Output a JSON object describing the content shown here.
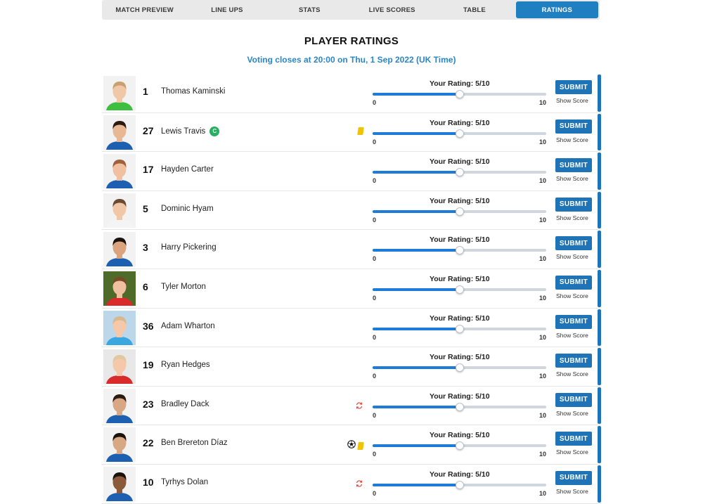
{
  "tabs": [
    {
      "label": "MATCH PREVIEW",
      "active": false
    },
    {
      "label": "LINE UPS",
      "active": false
    },
    {
      "label": "STATS",
      "active": false
    },
    {
      "label": "LIVE SCORES",
      "active": false
    },
    {
      "label": "TABLE",
      "active": false
    },
    {
      "label": "RATINGS",
      "active": true
    }
  ],
  "page_title": "PLAYER RATINGS",
  "voting_text": "Voting closes at 20:00 on Thu, 1 Sep 2022 (UK Time)",
  "slider_min_label": "0",
  "slider_max_label": "10",
  "submit_label": "SUBMIT",
  "show_score_label": "Show Score",
  "colors": {
    "accent": "#1f74b8",
    "tab_active": "#1f7fc0",
    "voting_text": "#2a86c6",
    "captain": "#27ae60",
    "yellow_card": "#f2c300",
    "sub_icon": "#e74c3c"
  },
  "players": [
    {
      "number": "1",
      "name": "Thomas Kaminski",
      "rating_label": "Your Rating: 5/10",
      "rating": 5,
      "captain": false,
      "events": [],
      "kit": "green",
      "bg": "#f2f2f2",
      "skin": "#f0c8a8",
      "hair": "#c9a070"
    },
    {
      "number": "27",
      "name": "Lewis Travis",
      "rating_label": "Your Rating: 5/10",
      "rating": 5,
      "captain": true,
      "captain_label": "C",
      "events": [
        "yellow-card"
      ],
      "kit": "blue",
      "bg": "#f2f2f2",
      "skin": "#e8b894",
      "hair": "#2a1a10"
    },
    {
      "number": "17",
      "name": "Hayden Carter",
      "rating_label": "Your Rating: 5/10",
      "rating": 5,
      "captain": false,
      "events": [],
      "kit": "blue",
      "bg": "#f2f2f2",
      "skin": "#f0c0a0",
      "hair": "#a0603a"
    },
    {
      "number": "5",
      "name": "Dominic Hyam",
      "rating_label": "Your Rating: 5/10",
      "rating": 5,
      "captain": false,
      "events": [],
      "kit": "white",
      "bg": "#f2f2f2",
      "skin": "#f0c8a8",
      "hair": "#6a4a30"
    },
    {
      "number": "3",
      "name": "Harry Pickering",
      "rating_label": "Your Rating: 5/10",
      "rating": 5,
      "captain": false,
      "events": [],
      "kit": "blue",
      "bg": "#f2f2f2",
      "skin": "#d9a47e",
      "hair": "#1a120c"
    },
    {
      "number": "6",
      "name": "Tyler Morton",
      "rating_label": "Your Rating: 5/10",
      "rating": 5,
      "captain": false,
      "events": [],
      "kit": "red",
      "bg": "#4f6b2a",
      "skin": "#f0c0a0",
      "hair": "#7a4a28"
    },
    {
      "number": "36",
      "name": "Adam Wharton",
      "rating_label": "Your Rating: 5/10",
      "rating": 5,
      "captain": false,
      "events": [],
      "kit": "sky",
      "bg": "#bcd6ea",
      "skin": "#f4c8a8",
      "hair": "#d8b890"
    },
    {
      "number": "19",
      "name": "Ryan Hedges",
      "rating_label": "Your Rating: 5/10",
      "rating": 5,
      "captain": false,
      "events": [],
      "kit": "red",
      "bg": "#e8e8e8",
      "skin": "#f4c8a8",
      "hair": "#e0c8a0"
    },
    {
      "number": "23",
      "name": "Bradley Dack",
      "rating_label": "Your Rating: 5/10",
      "rating": 5,
      "captain": false,
      "events": [
        "sub"
      ],
      "kit": "blue",
      "bg": "#f2f2f2",
      "skin": "#d8a884",
      "hair": "#2a1a10"
    },
    {
      "number": "22",
      "name": "Ben Brereton Díaz",
      "rating_label": "Your Rating: 5/10",
      "rating": 5,
      "captain": false,
      "events": [
        "goal",
        "yellow-card"
      ],
      "kit": "blue",
      "bg": "#f2f2f2",
      "skin": "#d8a884",
      "hair": "#1a120c"
    },
    {
      "number": "10",
      "name": "Tyrhys Dolan",
      "rating_label": "Your Rating: 5/10",
      "rating": 5,
      "captain": false,
      "events": [
        "sub"
      ],
      "kit": "blue",
      "bg": "#f2f2f2",
      "skin": "#8a5a3a",
      "hair": "#1a120c"
    }
  ]
}
